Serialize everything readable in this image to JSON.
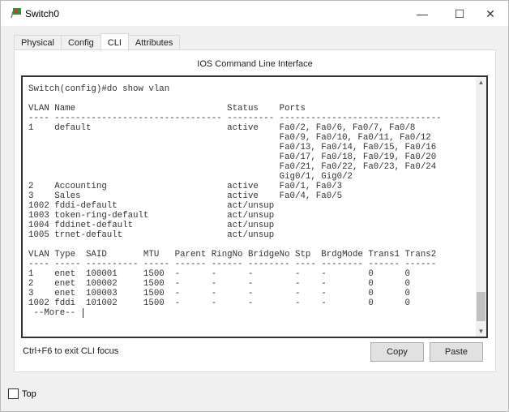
{
  "window": {
    "title": "Switch0"
  },
  "tabs": [
    "Physical",
    "Config",
    "CLI",
    "Attributes"
  ],
  "active_tab": "CLI",
  "panel_title": "IOS Command Line Interface",
  "terminal": {
    "lines": [
      "Switch(config)#do show vlan",
      "",
      "VLAN Name                             Status    Ports",
      "---- -------------------------------- --------- -------------------------------",
      "1    default                          active    Fa0/2, Fa0/6, Fa0/7, Fa0/8",
      "                                                Fa0/9, Fa0/10, Fa0/11, Fa0/12",
      "                                                Fa0/13, Fa0/14, Fa0/15, Fa0/16",
      "                                                Fa0/17, Fa0/18, Fa0/19, Fa0/20",
      "                                                Fa0/21, Fa0/22, Fa0/23, Fa0/24",
      "                                                Gig0/1, Gig0/2",
      "2    Accounting                       active    Fa0/1, Fa0/3",
      "3    Sales                            active    Fa0/4, Fa0/5",
      "1002 fddi-default                     act/unsup",
      "1003 token-ring-default               act/unsup",
      "1004 fddinet-default                  act/unsup",
      "1005 trnet-default                    act/unsup",
      "",
      "VLAN Type  SAID       MTU   Parent RingNo BridgeNo Stp  BrdgMode Trans1 Trans2",
      "---- ----- ---------- ----- ------ ------ -------- ---- -------- ------ ------",
      "1    enet  100001     1500  -      -      -        -    -        0      0",
      "2    enet  100002     1500  -      -      -        -    -        0      0",
      "3    enet  100003     1500  -      -      -        -    -        0      0",
      "1002 fddi  101002     1500  -      -      -        -    -        0      0"
    ],
    "more_prompt": " --More-- "
  },
  "hint": "Ctrl+F6 to exit CLI focus",
  "buttons": {
    "copy": "Copy",
    "paste": "Paste"
  },
  "top_checkbox": {
    "label": "Top",
    "checked": false
  }
}
